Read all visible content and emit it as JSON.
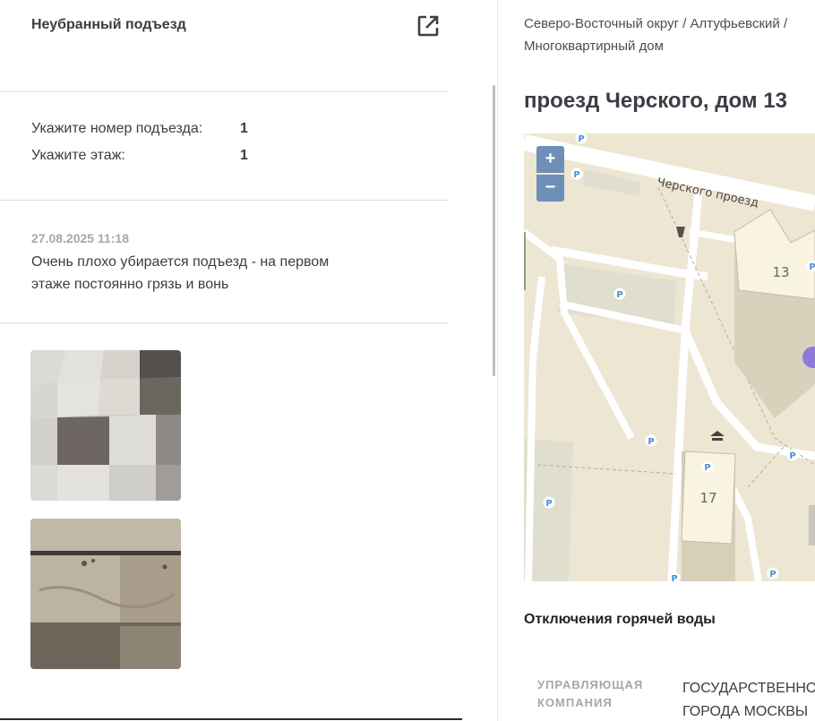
{
  "issue": {
    "title": "Неубранный подъезд",
    "fields": [
      {
        "label": "Укажите номер подъезда:",
        "value": "1"
      },
      {
        "label": "Укажите этаж:",
        "value": "1"
      }
    ],
    "comment": {
      "date": "27.08.2025 11:18",
      "text": "Очень плохо убирается подъезд - на первом этаже постоянно грязь и вонь"
    },
    "icons": {
      "open_external": "open-in-new-icon"
    }
  },
  "location": {
    "breadcrumb": "Северо-Восточный округ / Алтуфьевский / Многоквартирный дом",
    "address": "проезд Черского, дом 13"
  },
  "map": {
    "zoom_in": "+",
    "zoom_out": "−",
    "street_label": "Черского проезд",
    "building_13": "13",
    "building_17": "17",
    "parking_label": "P"
  },
  "hot_water": {
    "title": "Отключения горячей воды",
    "company_label": "УПРАВЛЯЮЩАЯ КОМПАНИЯ",
    "company_value_line1": "ГОСУДАРСТВЕННОЕ",
    "company_value_line2": "ГОРОДА МОСКВЫ"
  },
  "colors": {
    "map_bg": "#ede6d2",
    "zoom_button": "#6e8fb8",
    "building": "#f7f3df",
    "marker": "#8d7bd8"
  }
}
